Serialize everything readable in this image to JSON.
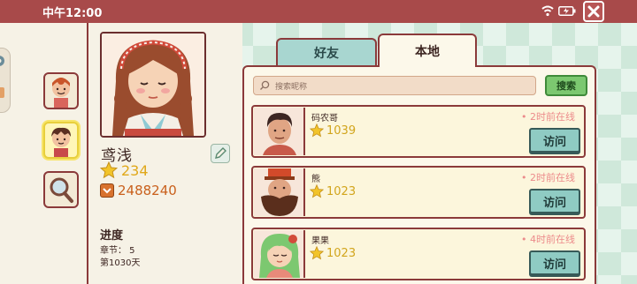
{
  "status_bar": {
    "time": "中午12:00"
  },
  "player": {
    "name": "鸢浅",
    "stars": "234",
    "coins": "2488240",
    "progress_title": "进度",
    "chapter": "章节： 5",
    "days": "第1030天"
  },
  "tabs": {
    "friends": "好友",
    "local": "本地"
  },
  "search": {
    "placeholder": "搜索昵称",
    "button": "搜索"
  },
  "friends": [
    {
      "name": "码农哥",
      "score": "1039",
      "status": "2时前在线",
      "visit": "访问"
    },
    {
      "name": "熊",
      "score": "1023",
      "status": "2时前在线",
      "visit": "访问"
    },
    {
      "name": "果果",
      "score": "1023",
      "status": "4时前在线",
      "visit": "访问"
    }
  ],
  "colors": {
    "accent": "#8b3a3a",
    "status_bar": "#a84a4a",
    "star": "#e8b820",
    "coin": "#d8722e",
    "search_button": "#7cc870",
    "visit_button": "#8fcbc3",
    "online_status": "#ec8b8b"
  }
}
